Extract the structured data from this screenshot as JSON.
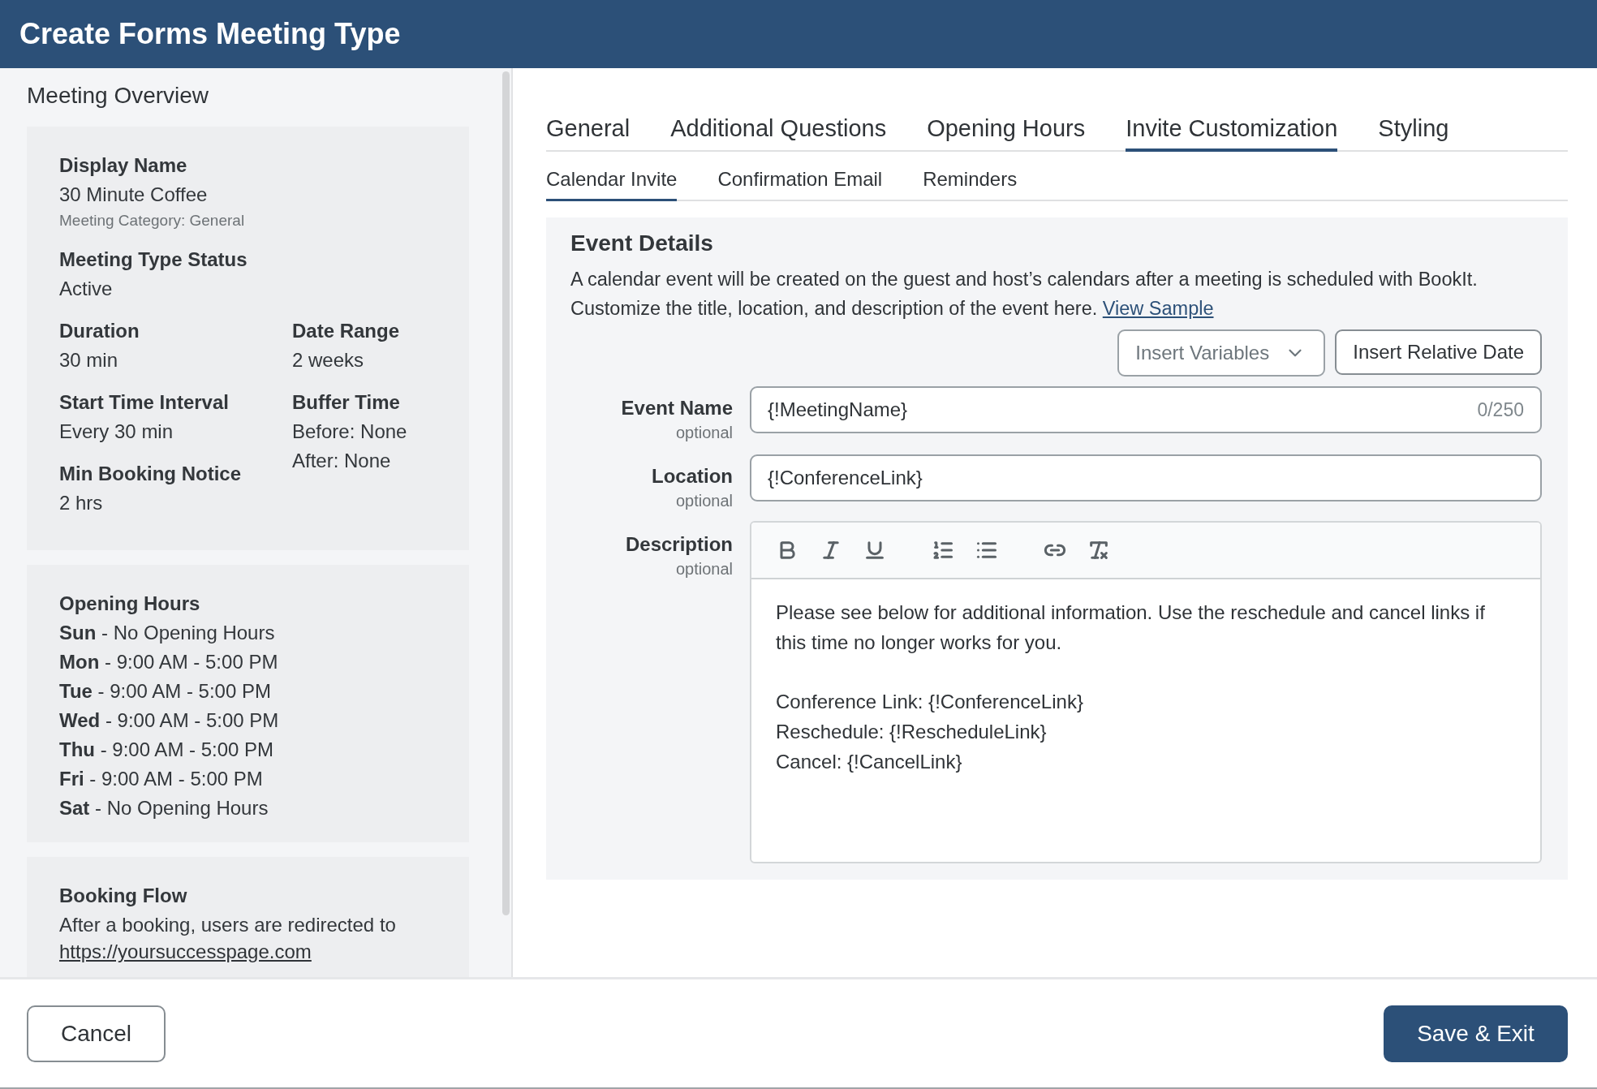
{
  "header": {
    "title": "Create Forms Meeting Type"
  },
  "overview": {
    "title": "Meeting Overview",
    "summary_card": {
      "top_fields": [
        {
          "label": "Display Name",
          "values": [
            "30 Minute Coffee"
          ],
          "note": "Meeting Category: General"
        },
        {
          "label": "Meeting Type Status",
          "values": [
            "Active"
          ]
        }
      ],
      "left_fields": [
        {
          "label": "Duration",
          "values": [
            "30 min"
          ]
        },
        {
          "label": "Start Time Interval",
          "values": [
            "Every 30 min"
          ]
        },
        {
          "label": "Min Booking Notice",
          "values": [
            "2 hrs"
          ]
        }
      ],
      "right_fields": [
        {
          "label": "Date Range",
          "values": [
            "2 weeks"
          ]
        },
        {
          "label": "Buffer Time",
          "values": [
            "Before: None",
            "After: None"
          ]
        }
      ]
    },
    "opening_hours_card": {
      "title": "Opening Hours",
      "rows": [
        "**Sun** - No Opening Hours",
        "**Mon** - 9:00 AM - 5:00 PM",
        "**Tue** - 9:00 AM - 5:00 PM",
        "**Wed** - 9:00 AM - 5:00 PM",
        "**Thu** - 9:00 AM - 5:00 PM",
        "**Fri** - 9:00 AM - 5:00 PM",
        "**Sat** - No Opening Hours"
      ]
    },
    "booking_flow_card": {
      "title": "Booking Flow",
      "text": "After a booking, users are redirected to",
      "link": "https://yoursuccesspage.com"
    }
  },
  "tabs": [
    {
      "label": "General",
      "selected": false
    },
    {
      "label": "Additional Questions",
      "selected": false
    },
    {
      "label": "Opening Hours",
      "selected": false
    },
    {
      "label": "Invite Customization",
      "selected": true
    },
    {
      "label": "Styling",
      "selected": false
    }
  ],
  "subtabs": [
    {
      "label": "Calendar Invite",
      "selected": true
    },
    {
      "label": "Confirmation Email",
      "selected": false
    },
    {
      "label": "Reminders",
      "selected": false
    }
  ],
  "event_details": {
    "title": "Event Details",
    "description": "A calendar event will be created on the guest and host’s calendars after a meeting is scheduled with BookIt. Customize the title, location, and description of the event here.",
    "link": "View Sample",
    "insert_variables": {
      "placeholder": "Insert Variables"
    },
    "insert_relative_date": "Insert Relative Date",
    "fields": [
      {
        "label": "Event Name",
        "hint": "optional",
        "value": "{!MeetingName}",
        "counter": "0/250"
      },
      {
        "label": "Location",
        "hint": "optional",
        "value": "{!ConferenceLink}"
      }
    ],
    "description_field": {
      "label": "Description",
      "hint": "optional",
      "paragraphs": [
        [
          "Please see below for additional information. Use the reschedule and cancel links if this time no longer works for you."
        ],
        [
          "Conference Link: {!ConferenceLink}",
          "Reschedule: {!RescheduleLink}",
          "Cancel: {!CancelLink}"
        ]
      ]
    }
  },
  "footer": {
    "cancel": "Cancel",
    "save": "Save & Exit"
  }
}
